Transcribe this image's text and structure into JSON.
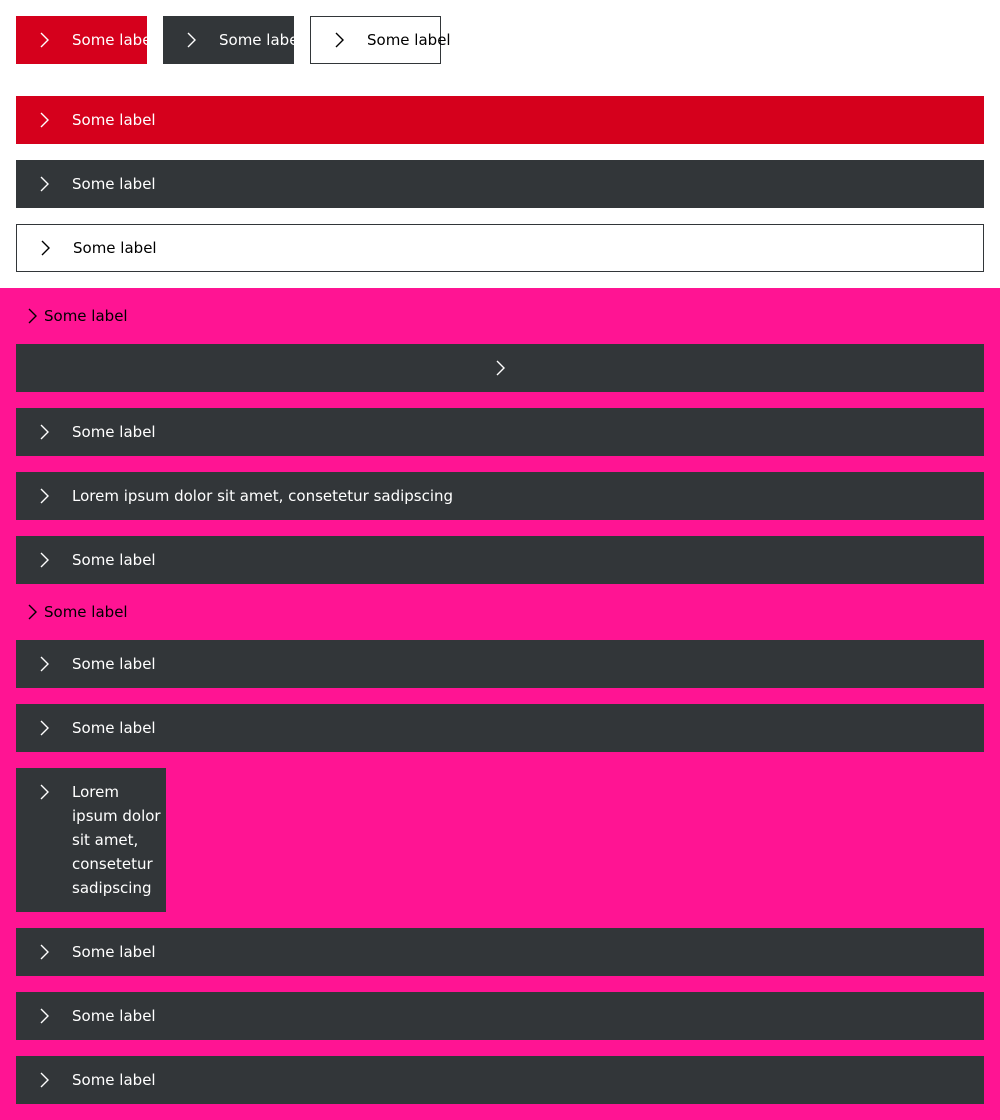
{
  "buttons": {
    "row1": [
      "Some label",
      "Some label",
      "Some label"
    ],
    "fullwidth_primary": "Some label",
    "fullwidth_secondary": "Some label",
    "fullwidth_tertiary": "Some label",
    "pink_link_1": "Some label",
    "pink_items": [
      "Some label",
      "Lorem ipsum dolor sit amet, consetetur sadipscing",
      "Some label"
    ],
    "pink_link_2": "Some label",
    "pink_items_2": [
      "Some label",
      "Some label",
      "Lorem ipsum dolor sit amet, consetetur sadipscing",
      "Some label",
      "Some label",
      "Some label"
    ]
  },
  "colors": {
    "primary": "#d5001c",
    "secondary": "#323639",
    "background_pink": "#ff1493"
  },
  "icons": {
    "arrow": "chevron-right-icon"
  }
}
